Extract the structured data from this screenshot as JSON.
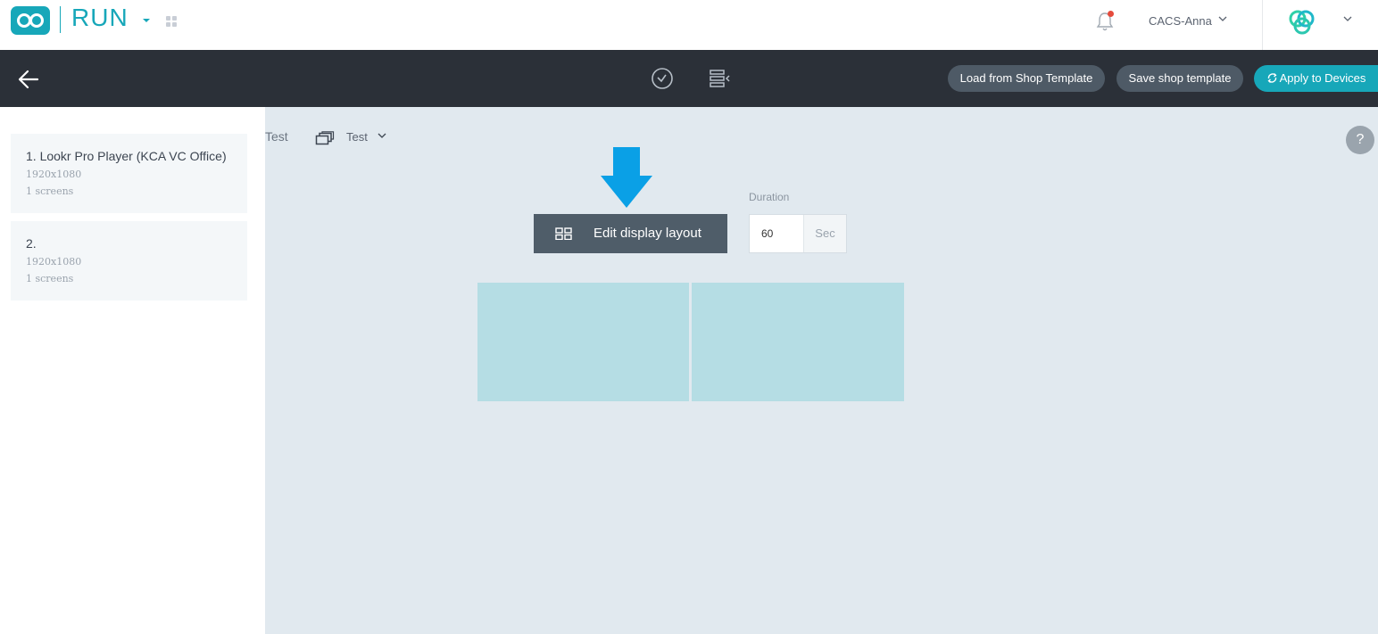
{
  "header": {
    "app_name": "RUN",
    "user_name": "CACS-Anna"
  },
  "toolbar": {
    "load_template_label": "Load from Shop Template",
    "save_template_label": "Save shop template",
    "apply_devices_label": "Apply to Devices"
  },
  "sidebar": {
    "items": [
      {
        "title": "1. Lookr Pro Player (KCA VC Office)",
        "resolution": "1920x1080",
        "screens": "1 screens"
      },
      {
        "title": "2.",
        "resolution": "1920x1080",
        "screens": "1 screens"
      }
    ]
  },
  "main": {
    "tab_label": "Test",
    "dropdown_label": "Test",
    "help_label": "?",
    "edit_layout_label": "Edit display layout",
    "duration_label": "Duration",
    "duration_value": "60",
    "duration_unit": "Sec"
  },
  "colors": {
    "accent": "#17a7b9",
    "toolbar_bg": "#2b3038",
    "canvas_bg": "#e1e9ef",
    "zone_fill": "#b5dde4",
    "hint_arrow": "#0aa0e6"
  },
  "icons": [
    "infinity-logo-icon",
    "apps-grid-icon",
    "bell-icon",
    "chevron-down-icon",
    "brand-rings-icon",
    "back-arrow-icon",
    "clock-icon",
    "playlist-icon",
    "refresh-icon",
    "windows-icon",
    "layout-grid-icon",
    "down-arrow-icon"
  ]
}
